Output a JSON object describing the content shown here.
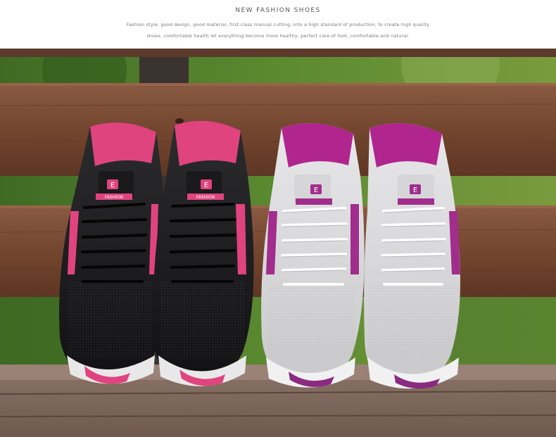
{
  "header": {
    "title": "NEW FASHION SHOES",
    "description_line1": "Fashion style, good design, good material, first-class manual cutting, into a high standard of production, to create high quality",
    "description_line2": "shoes, comfortable health let everything become more healthy, perfect care of foot, comfortable and natural."
  },
  "product": {
    "tongue_label": "FASHION",
    "logo_letter": "E",
    "colors": {
      "black_pair_accent": "#e0447f",
      "grey_pair_accent": "#a12d8c",
      "bench_wood": "#7a4a35",
      "foliage": "#4f7a2c"
    }
  }
}
